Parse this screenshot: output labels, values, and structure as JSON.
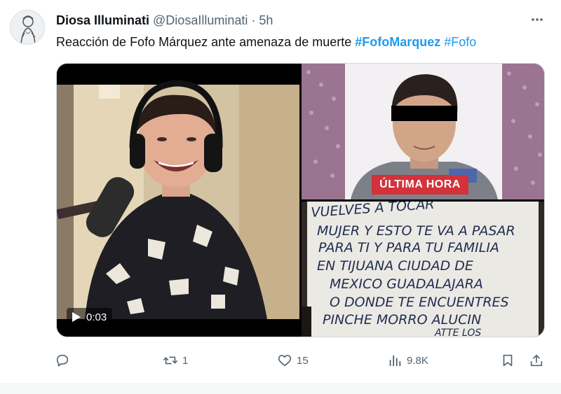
{
  "tweet": {
    "author": {
      "display_name": "Diosa Illuminati",
      "handle": "@DiosaIlluminati",
      "separator": "·",
      "time": "5h",
      "avatar_icon": "avatar-statue-icon"
    },
    "more_icon": "more-dots-icon",
    "text": "Reacción de Fofo Márquez ante amenaza de muerte",
    "hashtags": [
      "#FofoMarquez",
      "#Fofo"
    ],
    "media": {
      "video_time": "0:03",
      "badge": "ÚLTIMA HORA",
      "sign_lines": [
        "VUELVES A TOCAR",
        "MUJER Y ESTO TE VA A PASAR",
        "PARA TI Y PARA TU FAMILIA",
        "EN TIJUANA CIUDAD DE",
        "MEXICO GUADALAJARA",
        "O DONDE TE ENCUENTRES",
        "PINCHE MORRO ALUCIN",
        "ATTE LOS"
      ]
    },
    "actions": {
      "reply": {
        "icon": "reply-icon",
        "count": ""
      },
      "retweet": {
        "icon": "retweet-icon",
        "count": "1"
      },
      "like": {
        "icon": "heart-icon",
        "count": "15"
      },
      "views": {
        "icon": "views-icon",
        "count": "9.8K"
      },
      "bookmark": {
        "icon": "bookmark-icon"
      },
      "share": {
        "icon": "share-icon"
      }
    },
    "colors": {
      "accent": "#1d9bf0",
      "muted": "#536471",
      "badge": "#d3323a"
    }
  }
}
